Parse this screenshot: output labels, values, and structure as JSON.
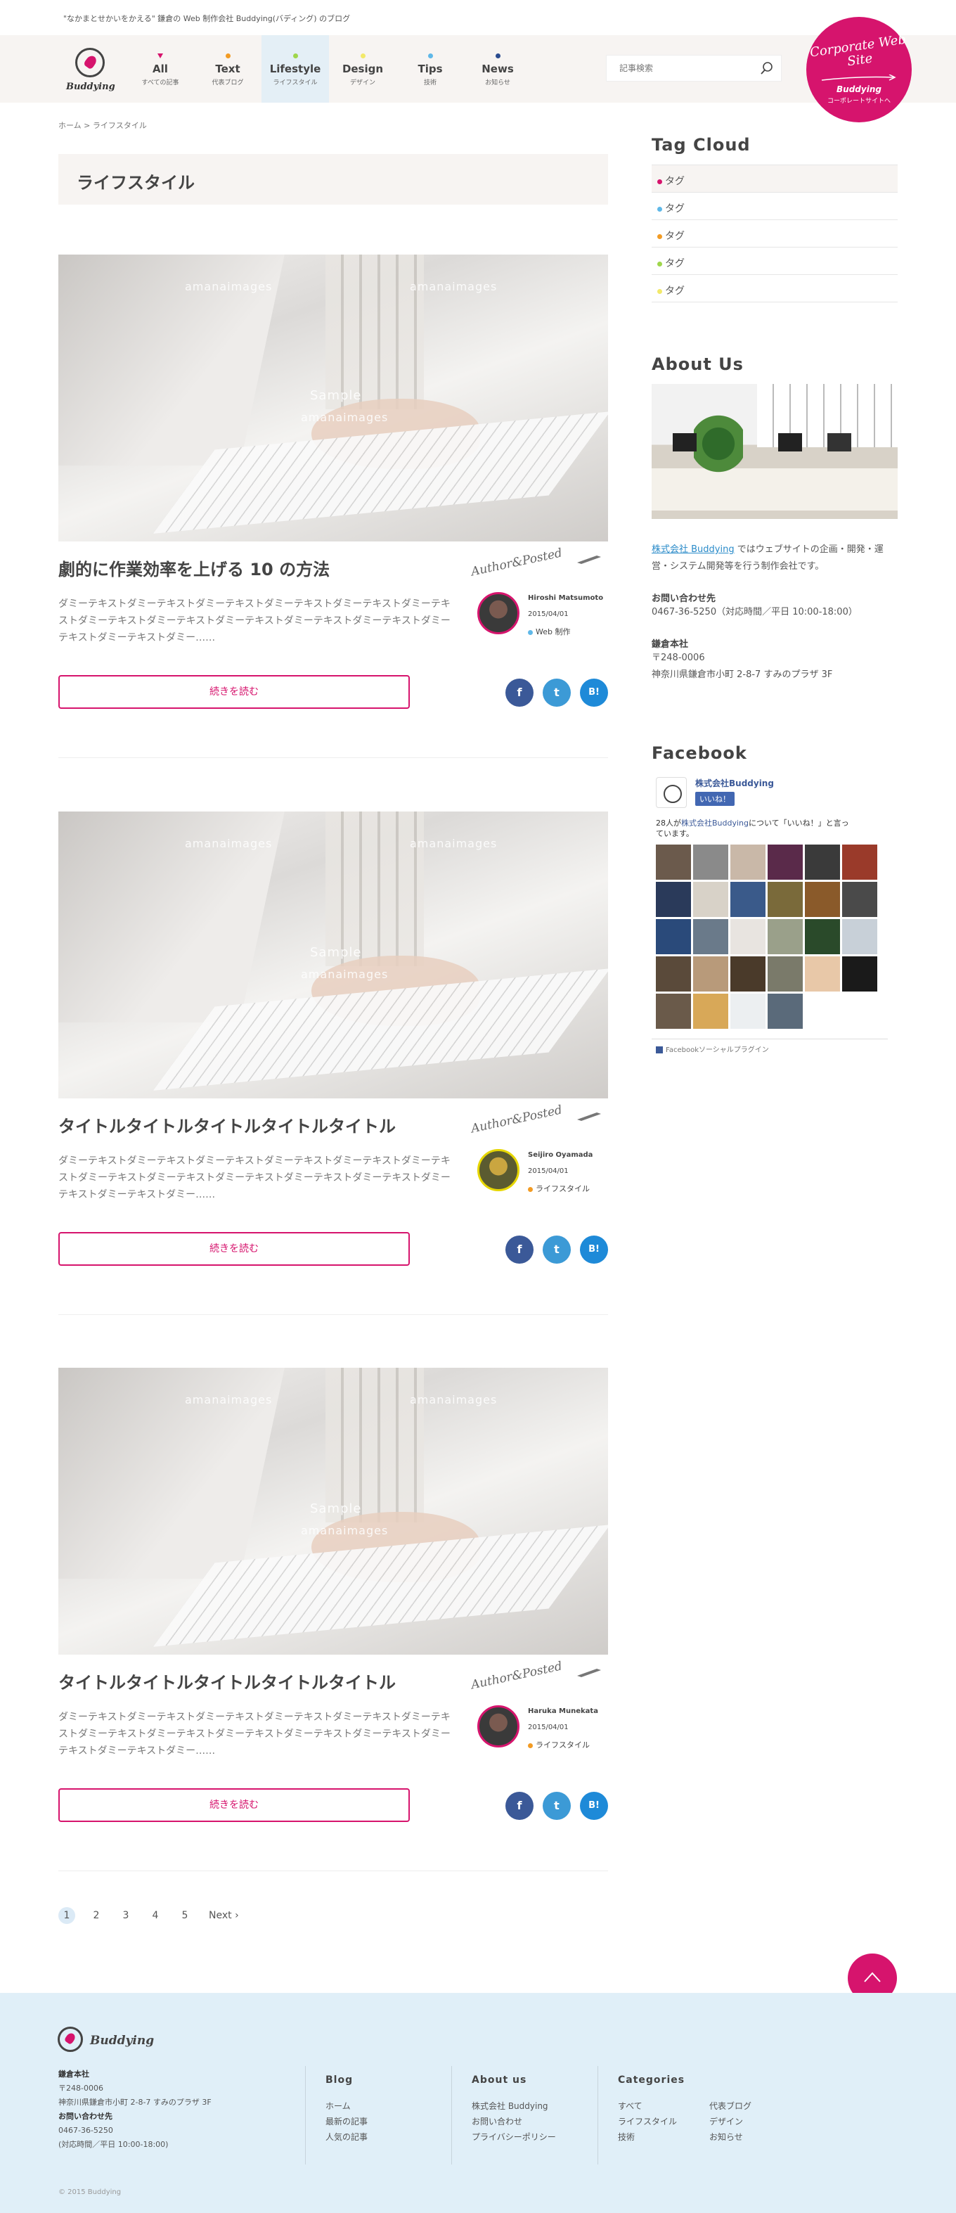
{
  "tagline": "\"なかまとせかいをかえる\" 鎌倉の Web 制作会社 Buddying(バディング) のブログ",
  "brand": "Buddying",
  "nav": [
    {
      "label": "All",
      "sub": "すべての記事",
      "color": "#d6146d"
    },
    {
      "label": "Text",
      "sub": "代表ブログ",
      "color": "#f29b24"
    },
    {
      "label": "Lifestyle",
      "sub": "ライフスタイル",
      "color": "#9fd64b"
    },
    {
      "label": "Design",
      "sub": "デザイン",
      "color": "#f2e96a"
    },
    {
      "label": "Tips",
      "sub": "技術",
      "color": "#5fb8e8"
    },
    {
      "label": "News",
      "sub": "お知らせ",
      "color": "#2a4b8f"
    }
  ],
  "search": {
    "placeholder": "記事検索"
  },
  "corporate": {
    "title": "Corporate Web Site",
    "brand": "Buddying",
    "sub": "コーポレートサイトへ"
  },
  "breadcrumb": "ホーム > ライフスタイル",
  "page_title": "ライフスタイル",
  "read_more": "続きを読む",
  "author_sign": "Author&Posted",
  "image_watermark": {
    "brand": "amanaimages",
    "sample": "Sample"
  },
  "posts": [
    {
      "title": "劇的に作業効率を上げる 10 の方法",
      "excerpt": "ダミーテキストダミーテキストダミーテキストダミーテキストダミーテキストダミーテキストダミーテキストダミーテキストダミーテキストダミーテキストダミーテキストダミーテキストダミーテキストダミー……",
      "author": "Hiroshi Matsumoto",
      "date": "2015/04/01",
      "category": "Web 制作",
      "category_color": "#5fb8e8"
    },
    {
      "title": "タイトルタイトルタイトルタイトルタイトル",
      "excerpt": "ダミーテキストダミーテキストダミーテキストダミーテキストダミーテキストダミーテキストダミーテキストダミーテキストダミーテキストダミーテキストダミーテキストダミーテキストダミーテキストダミー……",
      "author": "Seijiro Oyamada",
      "date": "2015/04/01",
      "category": "ライフスタイル",
      "category_color": "#f29b24"
    },
    {
      "title": "タイトルタイトルタイトルタイトルタイトル",
      "excerpt": "ダミーテキストダミーテキストダミーテキストダミーテキストダミーテキストダミーテキストダミーテキストダミーテキストダミーテキストダミーテキストダミーテキストダミーテキストダミーテキストダミー……",
      "author": "Haruka Munekata",
      "date": "2015/04/01",
      "category": "ライフスタイル",
      "category_color": "#f29b24"
    }
  ],
  "share": {
    "facebook": "f",
    "twitter": "t",
    "hatena": "B!"
  },
  "pagination": {
    "pages": [
      "1",
      "2",
      "3",
      "4",
      "5"
    ],
    "current": "1",
    "next": "Next"
  },
  "sidebar": {
    "tag_cloud_title": "Tag Cloud",
    "tags": [
      {
        "label": "タグ",
        "color": "#d6146d"
      },
      {
        "label": "タグ",
        "color": "#5fb8e8"
      },
      {
        "label": "タグ",
        "color": "#f29b24"
      },
      {
        "label": "タグ",
        "color": "#9fd64b"
      },
      {
        "label": "タグ",
        "color": "#f2e96a"
      }
    ],
    "about_title": "About Us",
    "about_company": "株式会社 Buddying",
    "about_desc": " ではウェブサイトの企画・開発・運営・システム開発等を行う制作会社です。",
    "contact_title": "お問い合わせ先",
    "contact_tel": "0467-36-5250（対応時間／平日 10:00-18:00）",
    "office_title": "鎌倉本社",
    "office_zip": "〒248-0006",
    "office_addr": "神奈川県鎌倉市小町 2-8-7 すみのプラザ 3F",
    "facebook_title": "Facebook",
    "fb_page": "株式会社Buddying",
    "fb_like": "いいね！",
    "fb_count_pre": "28人が",
    "fb_count_link": "株式会社Buddying",
    "fb_count_post": "について「いいね！」と言っています。",
    "fb_plugin": "Facebookソーシャルプラグイン"
  },
  "footer": {
    "brand": "Buddying",
    "office_title": "鎌倉本社",
    "zip": "〒248-0006",
    "addr": "神奈川県鎌倉市小町 2-8-7 すみのプラザ 3F",
    "contact_title": "お問い合わせ先",
    "tel": "0467-36-5250",
    "hours": "(対応時間／平日 10:00-18:00)",
    "blog_title": "Blog",
    "blog_links": [
      "ホーム",
      "最新の記事",
      "人気の記事"
    ],
    "about_title": "About us",
    "about_links": [
      "株式会社 Buddying",
      "お問い合わせ",
      "プライバシーポリシー"
    ],
    "cat_title": "Categories",
    "cat_links": [
      "すべて",
      "代表ブログ",
      "ライフスタイル",
      "デザイン",
      "技術",
      "お知らせ"
    ],
    "copyright": "© 2015 Buddying"
  }
}
